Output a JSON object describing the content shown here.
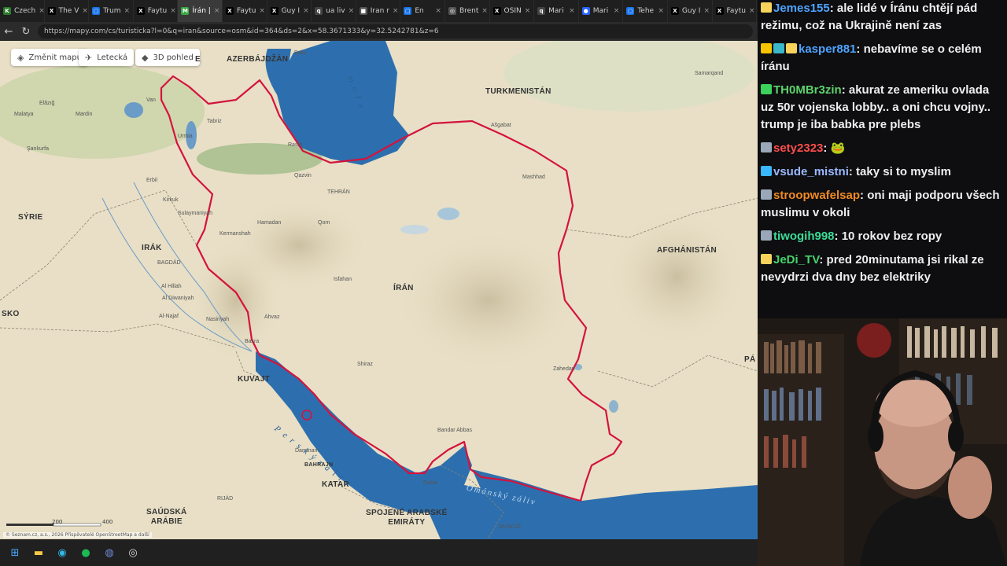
{
  "browser": {
    "tabs": [
      {
        "label": "Czech",
        "color": "#2a7a2a",
        "glyph": "K"
      },
      {
        "label": "The V",
        "color": "#000",
        "glyph": "X"
      },
      {
        "label": "Trum",
        "color": "#1a73e8",
        "glyph": "▢"
      },
      {
        "label": "Faytu",
        "color": "#000",
        "glyph": "X"
      },
      {
        "label": "Írán |",
        "color": "#39a845",
        "glyph": "M",
        "active": true
      },
      {
        "label": "Faytu",
        "color": "#000",
        "glyph": "X"
      },
      {
        "label": "Guy I",
        "color": "#000",
        "glyph": "X"
      },
      {
        "label": "ua liv",
        "color": "#444",
        "glyph": "q"
      },
      {
        "label": "Iran r",
        "color": "#555",
        "glyph": "■"
      },
      {
        "label": "En",
        "color": "#1a73e8",
        "glyph": "▢"
      },
      {
        "label": "Brent",
        "color": "#555",
        "glyph": "◎"
      },
      {
        "label": "OSIN",
        "color": "#000",
        "glyph": "X"
      },
      {
        "label": "Mari",
        "color": "#444",
        "glyph": "q"
      },
      {
        "label": "Mari",
        "color": "#2962ff",
        "glyph": "●"
      },
      {
        "label": "Tehe",
        "color": "#1a73e8",
        "glyph": "▢"
      },
      {
        "label": "Guy I",
        "color": "#000",
        "glyph": "X"
      },
      {
        "label": "Faytu",
        "color": "#000",
        "glyph": "X"
      }
    ],
    "url": "https://mapy.com/cs/turisticka?l=0&q=iran&source=osm&id=364&ds=2&x=58.3671333&y=32.5242781&z=6"
  },
  "map": {
    "tools": [
      "Změnit mapu",
      "Letecká",
      "3D pohled"
    ],
    "countries": [
      {
        "name": "AZERBÁJDŽÁN"
      },
      {
        "name": "TURKMENISTÁN"
      },
      {
        "name": "SÝRIE"
      },
      {
        "name": "IRÁK"
      },
      {
        "name": "ÍRÁN"
      },
      {
        "name": "AFGHÁNISTÁN"
      },
      {
        "name": "KUVAJT"
      },
      {
        "name": "BAHRAJN"
      },
      {
        "name": "KATAR"
      },
      {
        "name": "SAÚDSKÁ\nARÁBIE"
      },
      {
        "name": "SPOJENÉ ARABSKÉ\nEMIRÁTY"
      },
      {
        "name": "SKO"
      },
      {
        "name": "PÁ"
      },
      {
        "name": "E"
      }
    ],
    "cities": [
      {
        "name": "Tabriz"
      },
      {
        "name": "Urmia"
      },
      {
        "name": "Rasht"
      },
      {
        "name": "Qazvin"
      },
      {
        "name": "TEHRÁN"
      },
      {
        "name": "Qom"
      },
      {
        "name": "Hamadan"
      },
      {
        "name": "Kermanshah"
      },
      {
        "name": "Isfahan"
      },
      {
        "name": "Shiraz"
      },
      {
        "name": "Ahvaz"
      },
      {
        "name": "Basra"
      },
      {
        "name": "Mashhad"
      },
      {
        "name": "Ašgabat"
      },
      {
        "name": "Kirkuk"
      },
      {
        "name": "Sulaymaniyah"
      },
      {
        "name": "Erbil"
      },
      {
        "name": "BAGDÁD"
      },
      {
        "name": "Al Hillah"
      },
      {
        "name": "Al Diwaniyah"
      },
      {
        "name": "Al-Najaf"
      },
      {
        "name": "Nasiriyah"
      },
      {
        "name": "Bandar Abbas"
      },
      {
        "name": "Dammam"
      },
      {
        "name": "RIJÁD"
      },
      {
        "name": "Dubai"
      },
      {
        "name": "MUSCAT"
      },
      {
        "name": "Zahedan"
      },
      {
        "name": "Samarqand"
      },
      {
        "name": "Baku"
      },
      {
        "name": "Mardin"
      },
      {
        "name": "Elâzığ"
      },
      {
        "name": "Malatya"
      },
      {
        "name": "Şanlıurfa"
      },
      {
        "name": "Van"
      }
    ],
    "seas": [
      "m o ř e",
      "P e r s k ý  z á l i v",
      "Ománský záliv"
    ],
    "scale": [
      "200",
      "400"
    ],
    "copyright": "© Seznam.cz, a.s., 2026  Přispěvatelé OpenStreetMap a další"
  },
  "chat": {
    "messages": [
      {
        "user": "Jemes155",
        "color": "#4ea3ff",
        "badges": [
          "#f7d35b"
        ],
        "text": "ale lidé v Íránu chtějí pád režimu, což na Ukrajině není zas"
      },
      {
        "user": "kasper881",
        "color": "#4ea3ff",
        "badges": [
          "#f6c400",
          "#3ab7c8",
          "#f7d35b"
        ],
        "text": "nebavíme se o celém íránu"
      },
      {
        "user": "TH0MBr3zin",
        "color": "#5dd36b",
        "badges": [
          "#3cd15a"
        ],
        "text": "akurat ze ameriku ovlada uz 50r vojenska lobby.. a oni chcu vojny.. trump je iba babka pre plebs"
      },
      {
        "user": "sety2323",
        "color": "#ff4d4d",
        "badges": [
          "#9aa7b8"
        ],
        "text": "🐸"
      },
      {
        "user": "vsude_mistni",
        "color": "#9ab8ff",
        "badges": [
          "#3ab7ff"
        ],
        "text": "taky si to myslim"
      },
      {
        "user": "stroopwafelsap",
        "color": "#f08a24",
        "badges": [
          "#9aa7b8"
        ],
        "text": "oni maji podporu všech muslimu v okoli"
      },
      {
        "user": "tiwogih998",
        "color": "#3ddc97",
        "badges": [
          "#9aa7b8"
        ],
        "text": "10 rokov bez ropy"
      },
      {
        "user": "JeDi_TV",
        "color": "#47d36b",
        "badges": [
          "#f7d35b"
        ],
        "text": "pred 20minutama jsi rikal ze nevydrzi dva dny bez elektriky"
      }
    ]
  },
  "taskbar": [
    "windows-icon",
    "file-explorer-icon",
    "edge-icon",
    "spotify-icon",
    "discord-icon",
    "obs-icon"
  ],
  "colors": {
    "border": "#d4133d",
    "water": "#2d6fae",
    "land": "#e8dfc6"
  }
}
